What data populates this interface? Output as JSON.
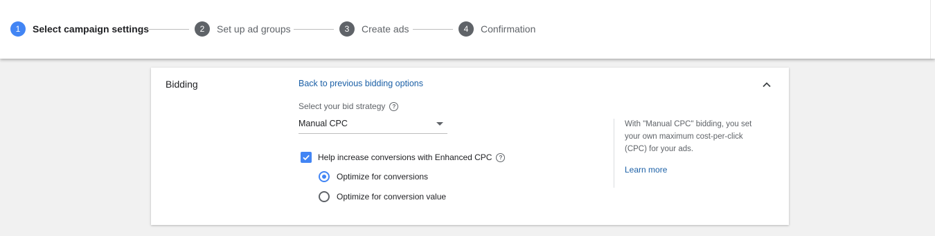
{
  "stepper": {
    "steps": [
      {
        "number": "1",
        "label": "Select campaign settings",
        "active": true
      },
      {
        "number": "2",
        "label": "Set up ad groups",
        "active": false
      },
      {
        "number": "3",
        "label": "Create ads",
        "active": false
      },
      {
        "number": "4",
        "label": "Confirmation",
        "active": false
      }
    ]
  },
  "bidding": {
    "title": "Bidding",
    "back_link": "Back to previous bidding options",
    "strategy_label": "Select your bid strategy",
    "strategy_value": "Manual CPC",
    "enhanced_cpc": {
      "label": "Help increase conversions with Enhanced CPC",
      "checked": true
    },
    "optimize_options": [
      {
        "label": "Optimize for conversions",
        "checked": true
      },
      {
        "label": "Optimize for conversion value",
        "checked": false
      }
    ],
    "sidebar_text": "With \"Manual CPC\" bidding, you set your own maximum cost-per-click (CPC) for your ads.",
    "learn_more": "Learn more"
  },
  "colors": {
    "accent": "#4285f4",
    "link": "#1a5fa6",
    "inactive_step": "#5f6368"
  },
  "icons": {
    "help": "help-icon",
    "collapse": "chevron-up-icon",
    "dropdown": "dropdown-arrow-icon",
    "check": "check-icon"
  }
}
